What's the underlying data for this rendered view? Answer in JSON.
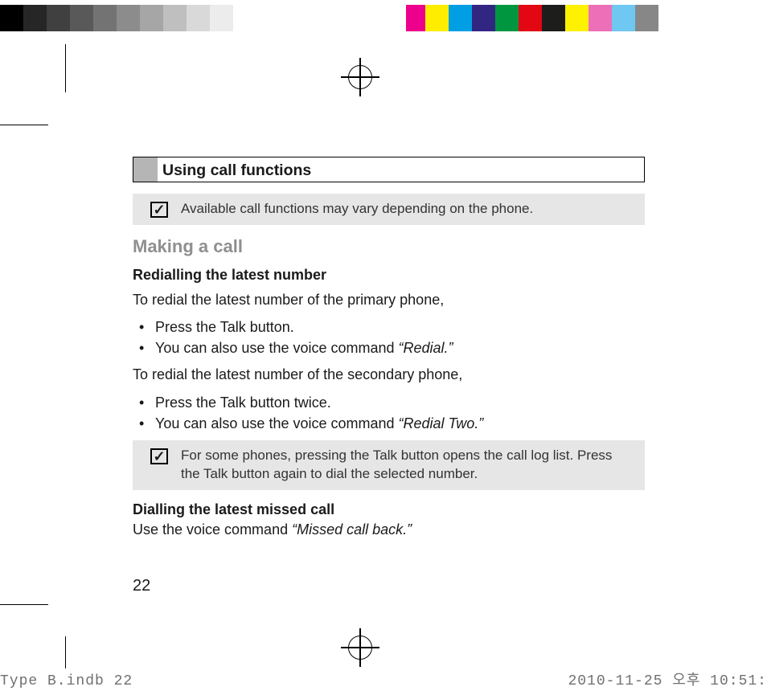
{
  "section_title": "Using call functions",
  "note1": "Available call functions may vary depending on the phone.",
  "h2": "Making a call",
  "h3a": "Redialling the latest number",
  "p1": "To redial the latest number of the primary phone,",
  "li1": "Press the Talk button.",
  "li2a": "You can also use the voice command ",
  "li2b": "“Redial.”",
  "p2": "To redial the latest number of the secondary phone,",
  "li3": "Press the Talk button twice.",
  "li4a": "You can also use the voice command ",
  "li4b": "“Redial Two.”",
  "note2": "For some phones, pressing the Talk button opens the call log list. Press the Talk button again to dial the selected number.",
  "h3b": "Dialling the latest missed call",
  "p3a": "Use the voice command ",
  "p3b": "“Missed call back.”",
  "page_number": "22",
  "footer_left": "Type B.indb   22",
  "footer_right": "2010-11-25   오후 10:51:"
}
